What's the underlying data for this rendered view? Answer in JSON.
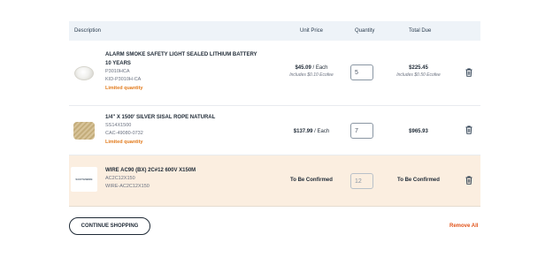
{
  "table": {
    "headers": {
      "description": "Description",
      "unit_price": "Unit Price",
      "quantity": "Quantity",
      "total_due": "Total Due"
    },
    "rows": [
      {
        "name": "ALARM SMOKE SAFETY LIGHT SEALED LITHIUM BATTERY 10 YEARS",
        "sku": "P3010HCA",
        "code": "KID-P3010H-CA",
        "limited": "Limited quantity",
        "price": "$45.09",
        "price_unit": " / Each",
        "price_note": "Includes $0.10 Ecofee",
        "quantity": "5",
        "total": "$225.45",
        "total_note": "Includes $0.50 Ecofee",
        "image_icon": "smoke-alarm-image"
      },
      {
        "name": "1/4\" X 1500' SILVER SISAL ROPE NATURAL",
        "sku": "SS14X1500",
        "code": "CAC-49080-0732",
        "limited": "Limited quantity",
        "price": "$137.99",
        "price_unit": " / Each",
        "quantity": "7",
        "total": "$965.93",
        "image_icon": "rope-image"
      },
      {
        "name": "WIRE AC90 (BX) 2C#12 600V X150M",
        "sku": "AC2C12X150",
        "code": "WIRE-AC2C12X150",
        "price": "To Be Confirmed",
        "quantity": "12",
        "total": "To Be Confirmed",
        "logo_text": "SOUTHWIRE",
        "image_icon": "brand-logo-image"
      }
    ]
  },
  "actions": {
    "continue_shopping": "CONTINUE SHOPPING",
    "remove_all": "Remove All"
  },
  "colors": {
    "header_bg": "#eef3f8",
    "highlight_row_bg": "#fbeee0",
    "limited_text": "#e27a1b",
    "remove_all_text": "#e2541b"
  }
}
